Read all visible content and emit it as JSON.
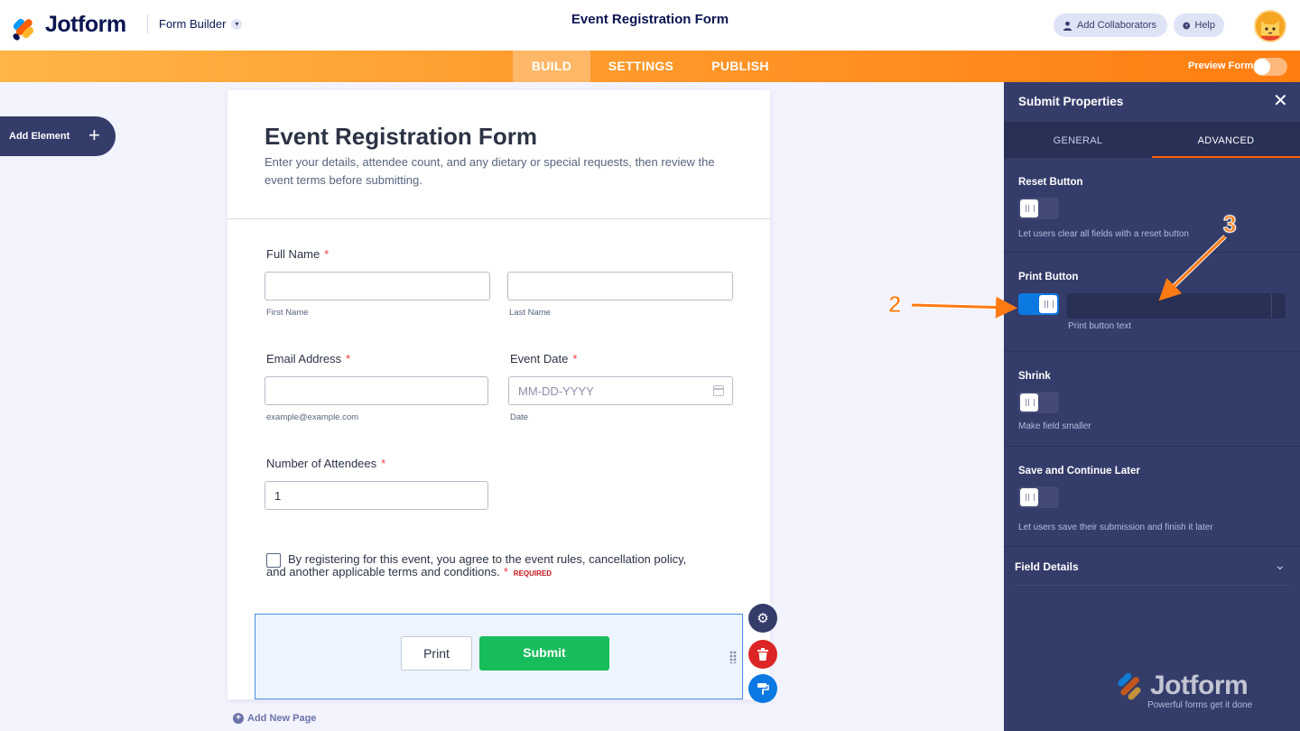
{
  "header": {
    "logo_text": "Jotform",
    "builder_label": "Form Builder",
    "form_title": "Event Registration Form",
    "add_collaborators": "Add Collaborators",
    "help": "Help"
  },
  "nav": {
    "tabs": [
      "BUILD",
      "SETTINGS",
      "PUBLISH"
    ],
    "active_tab": "BUILD",
    "preview_label": "Preview Form",
    "preview_enabled": false
  },
  "sidebar": {
    "add_element": "Add Element"
  },
  "form": {
    "title": "Event Registration Form",
    "description": "Enter your details, attendee count, and any dietary or special requests, then review the event terms before submitting.",
    "full_name_label": "Full Name",
    "first_name_sublabel": "First Name",
    "last_name_sublabel": "Last Name",
    "email_label": "Email Address",
    "email_sublabel": "example@example.com",
    "event_date_label": "Event Date",
    "event_date_placeholder": "MM-DD-YYYY",
    "event_date_sublabel": "Date",
    "attendees_label": "Number of Attendees",
    "attendees_value": "1",
    "required_mark": "*",
    "terms_text": "By registering for this event, you agree to the event rules, cancellation policy, and another applicable terms and conditions.",
    "required_tag": "REQUIRED",
    "print_button": "Print",
    "submit_button": "Submit",
    "add_new_page": "Add New Page"
  },
  "panel": {
    "title": "Submit Properties",
    "tabs": [
      "GENERAL",
      "ADVANCED"
    ],
    "active_tab": "ADVANCED",
    "reset_label": "Reset Button",
    "reset_desc": "Let users clear all fields with a reset button",
    "reset_on": false,
    "print_label": "Print Button",
    "print_on": true,
    "print_text_desc": "Print button text",
    "print_text_value": "",
    "shrink_label": "Shrink",
    "shrink_desc": "Make field smaller",
    "shrink_on": false,
    "save_label": "Save and Continue Later",
    "save_desc": "Let users save their submission and finish it later",
    "save_on": false,
    "field_details": "Field Details",
    "brand_word": "Jotform",
    "brand_tagline": "Powerful forms get it done"
  },
  "annotations": {
    "marker_2": "2",
    "marker_3": "3"
  },
  "colors": {
    "brand_orange": "#ff7d10",
    "panel_bg": "#343c6a",
    "submit_green": "#18bd5b",
    "toggle_on": "#0c79e2",
    "required_red": "#f23a3c"
  }
}
